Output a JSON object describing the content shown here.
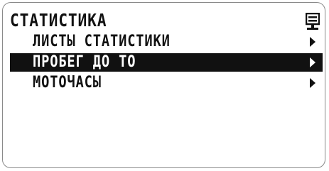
{
  "screen": {
    "title": "СТАТИСТИКА",
    "icon": "menu-list-icon"
  },
  "menu": {
    "items": [
      {
        "label": "ЛИСТЫ СТАТИСТИКИ",
        "selected": false,
        "icon": "arrow-right-icon"
      },
      {
        "label": "ПРОБЕГ ДО ТО",
        "selected": true,
        "icon": "arrow-right-icon"
      },
      {
        "label": "МОТОЧАСЫ",
        "selected": false,
        "icon": "arrow-right-icon"
      }
    ]
  },
  "colors": {
    "foreground": "#111111",
    "background": "#ffffff",
    "selected_background": "#111111",
    "selected_foreground": "#ffffff"
  }
}
